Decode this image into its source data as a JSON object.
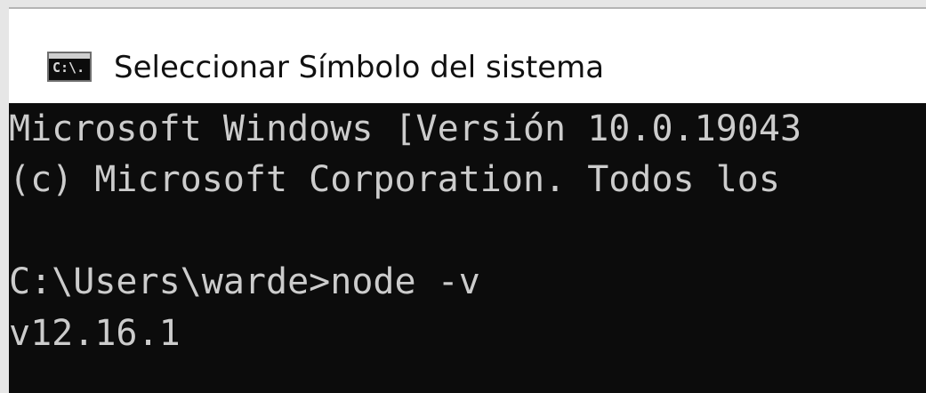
{
  "window": {
    "title": "Seleccionar Símbolo del sistema",
    "icon": "cmd-icon",
    "icon_glyph": "C:\\."
  },
  "console": {
    "lines": [
      "Microsoft Windows [Versión 10.0.19043",
      "(c) Microsoft Corporation. Todos los",
      "",
      "C:\\Users\\warde>node -v",
      "v12.16.1"
    ]
  },
  "colors": {
    "console_bg": "#0c0c0c",
    "console_text": "#cccccc",
    "titlebar_bg": "#ffffff"
  }
}
